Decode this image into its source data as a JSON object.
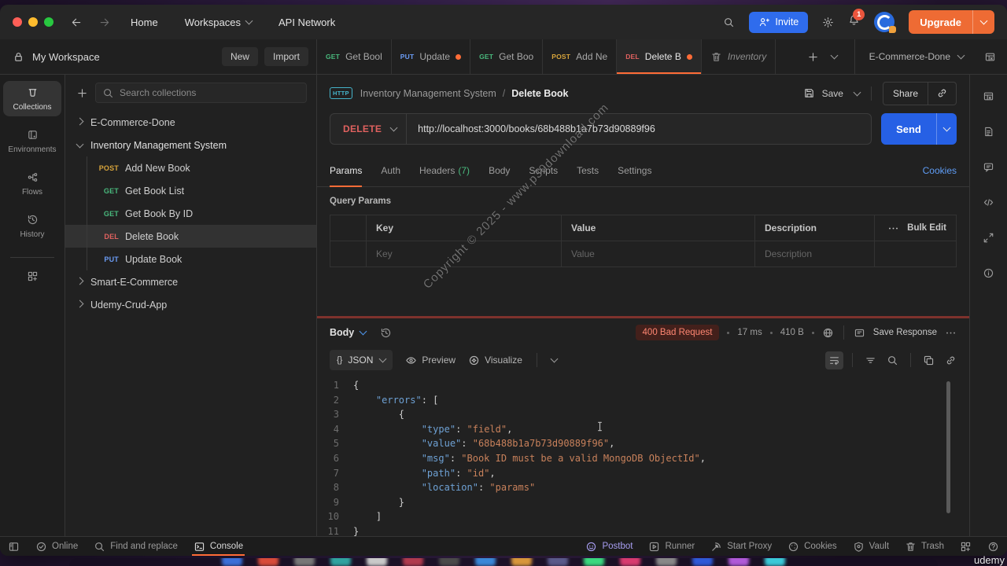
{
  "watermark": "Copyright © 2025 - www.p30download.com",
  "udemy_mark": "udemy",
  "colors": {
    "accent_orange": "#ff6c37",
    "primary_blue": "#2660e5",
    "link_blue": "#5f9df6",
    "error_text": "#ff8672",
    "traffic": [
      "#ff5f57",
      "#febc2e",
      "#28c840"
    ]
  },
  "method_colors": {
    "GET": "#49b97d",
    "POST": "#d7a43b",
    "DEL": "#e0615f",
    "PUT": "#6b9cf5",
    "DELETE": "#e0615f"
  },
  "titlebar": {
    "home": "Home",
    "workspaces": "Workspaces",
    "api_network": "API Network",
    "invite": "Invite",
    "notification_count": "1",
    "upgrade": "Upgrade"
  },
  "workspace_bar": {
    "name": "My Workspace",
    "new_button": "New",
    "import_button": "Import",
    "environment": "E-Commerce-Done"
  },
  "workspace_tabs": [
    {
      "method": "GET",
      "label": "Get Bool",
      "dirty": false,
      "active": false,
      "italic": false
    },
    {
      "method": "PUT",
      "label": "Update",
      "dirty": true,
      "active": false,
      "italic": false
    },
    {
      "method": "GET",
      "label": "Get Boo",
      "dirty": false,
      "active": false,
      "italic": false
    },
    {
      "method": "POST",
      "label": "Add Ne",
      "dirty": false,
      "active": false,
      "italic": false
    },
    {
      "method": "DEL",
      "label": "Delete B",
      "dirty": true,
      "active": true,
      "italic": false
    },
    {
      "method": "trash",
      "label": "Inventory",
      "dirty": false,
      "active": false,
      "italic": true
    }
  ],
  "left_rail": [
    {
      "icon": "collections-icon",
      "label": "Collections",
      "active": true
    },
    {
      "icon": "environments-icon",
      "label": "Environments",
      "active": false
    },
    {
      "icon": "flows-icon",
      "label": "Flows",
      "active": false
    },
    {
      "icon": "history-icon",
      "label": "History",
      "active": false
    }
  ],
  "sidebar": {
    "search_placeholder": "Search collections",
    "tree": [
      {
        "kind": "collection",
        "label": "E-Commerce-Done",
        "expanded": false,
        "selected": false
      },
      {
        "kind": "collection",
        "label": "Inventory Management System",
        "expanded": true,
        "selected": false
      },
      {
        "kind": "request",
        "method": "POST",
        "label": "Add New Book",
        "selected": false
      },
      {
        "kind": "request",
        "method": "GET",
        "label": "Get Book List",
        "selected": false
      },
      {
        "kind": "request",
        "method": "GET",
        "label": "Get Book By ID",
        "selected": false
      },
      {
        "kind": "request",
        "method": "DEL",
        "label": "Delete Book",
        "selected": true
      },
      {
        "kind": "request",
        "method": "PUT",
        "label": "Update Book",
        "selected": false
      },
      {
        "kind": "collection",
        "label": "Smart-E-Commerce",
        "expanded": false,
        "selected": false
      },
      {
        "kind": "collection",
        "label": "Udemy-Crud-App",
        "expanded": false,
        "selected": false
      }
    ]
  },
  "request": {
    "breadcrumb_collection": "Inventory Management System",
    "breadcrumb_separator": "/",
    "breadcrumb_request": "Delete Book",
    "save_label": "Save",
    "share_label": "Share",
    "method": "DELETE",
    "url": "http://localhost:3000/books/68b488b1a7b73d90889f96",
    "send_label": "Send",
    "tabs": [
      {
        "label": "Params",
        "count": "",
        "active": true
      },
      {
        "label": "Auth",
        "count": "",
        "active": false
      },
      {
        "label": "Headers",
        "count": "(7)",
        "active": false
      },
      {
        "label": "Body",
        "count": "",
        "active": false
      },
      {
        "label": "Scripts",
        "count": "",
        "active": false
      },
      {
        "label": "Tests",
        "count": "",
        "active": false
      },
      {
        "label": "Settings",
        "count": "",
        "active": false
      }
    ],
    "cookies_link": "Cookies",
    "query_params": {
      "title": "Query Params",
      "columns": [
        "Key",
        "Value",
        "Description"
      ],
      "bulk_edit": "Bulk Edit",
      "row_placeholders": [
        "Key",
        "Value",
        "Description"
      ]
    }
  },
  "response": {
    "body_label": "Body",
    "status": "400 Bad Request",
    "time": "17 ms",
    "size": "410 B",
    "save_response": "Save Response",
    "format_braces": "{}",
    "format": "JSON",
    "preview_label": "Preview",
    "visualize_label": "Visualize",
    "code": [
      {
        "n": "1",
        "seg": [
          [
            "p",
            "{"
          ]
        ]
      },
      {
        "n": "2",
        "seg": [
          [
            "p",
            "    "
          ],
          [
            "k",
            "\"errors\""
          ],
          [
            "p",
            ": ["
          ]
        ]
      },
      {
        "n": "3",
        "seg": [
          [
            "p",
            "        {"
          ]
        ]
      },
      {
        "n": "4",
        "seg": [
          [
            "p",
            "            "
          ],
          [
            "k",
            "\"type\""
          ],
          [
            "p",
            ": "
          ],
          [
            "s",
            "\"field\""
          ],
          [
            "p",
            ","
          ]
        ]
      },
      {
        "n": "5",
        "seg": [
          [
            "p",
            "            "
          ],
          [
            "k",
            "\"value\""
          ],
          [
            "p",
            ": "
          ],
          [
            "s",
            "\"68b488b1a7b73d90889f96\""
          ],
          [
            "p",
            ","
          ]
        ]
      },
      {
        "n": "6",
        "seg": [
          [
            "p",
            "            "
          ],
          [
            "k",
            "\"msg\""
          ],
          [
            "p",
            ": "
          ],
          [
            "s",
            "\"Book ID must be a valid MongoDB ObjectId\""
          ],
          [
            "p",
            ","
          ]
        ]
      },
      {
        "n": "7",
        "seg": [
          [
            "p",
            "            "
          ],
          [
            "k",
            "\"path\""
          ],
          [
            "p",
            ": "
          ],
          [
            "s",
            "\"id\""
          ],
          [
            "p",
            ","
          ]
        ]
      },
      {
        "n": "8",
        "seg": [
          [
            "p",
            "            "
          ],
          [
            "k",
            "\"location\""
          ],
          [
            "p",
            ": "
          ],
          [
            "s",
            "\"params\""
          ]
        ]
      },
      {
        "n": "9",
        "seg": [
          [
            "p",
            "        }"
          ]
        ]
      },
      {
        "n": "10",
        "seg": [
          [
            "p",
            "    ]"
          ]
        ]
      },
      {
        "n": "11",
        "seg": [
          [
            "p",
            "}"
          ]
        ]
      }
    ]
  },
  "status_bar": {
    "left": [
      {
        "icon": "panel-toggle-icon",
        "label": "",
        "active": false,
        "tint": false
      },
      {
        "icon": "check-circle-icon",
        "label": "Online",
        "active": false,
        "tint": false
      },
      {
        "icon": "search-icon",
        "label": "Find and replace",
        "active": false,
        "tint": false
      },
      {
        "icon": "console-icon",
        "label": "Console",
        "active": true,
        "tint": false
      }
    ],
    "right": [
      {
        "icon": "postbot-icon",
        "label": "Postbot",
        "active": false,
        "tint": true
      },
      {
        "icon": "runner-icon",
        "label": "Runner",
        "active": false,
        "tint": false
      },
      {
        "icon": "proxy-icon",
        "label": "Start Proxy",
        "active": false,
        "tint": false
      },
      {
        "icon": "cookie-icon",
        "label": "Cookies",
        "active": false,
        "tint": false
      },
      {
        "icon": "vault-icon",
        "label": "Vault",
        "active": false,
        "tint": false
      },
      {
        "icon": "trash-icon",
        "label": "Trash",
        "active": false,
        "tint": false
      },
      {
        "icon": "windows-icon",
        "label": "",
        "active": false,
        "tint": false
      },
      {
        "icon": "help-icon",
        "label": "",
        "active": false,
        "tint": false
      }
    ]
  },
  "right_rail": [
    {
      "icon": "env-quicklook-icon"
    },
    {
      "icon": "documentation-icon"
    },
    {
      "icon": "comments-icon"
    },
    {
      "icon": "code-icon"
    },
    {
      "icon": "sync-icon"
    },
    {
      "icon": "info-icon"
    }
  ]
}
